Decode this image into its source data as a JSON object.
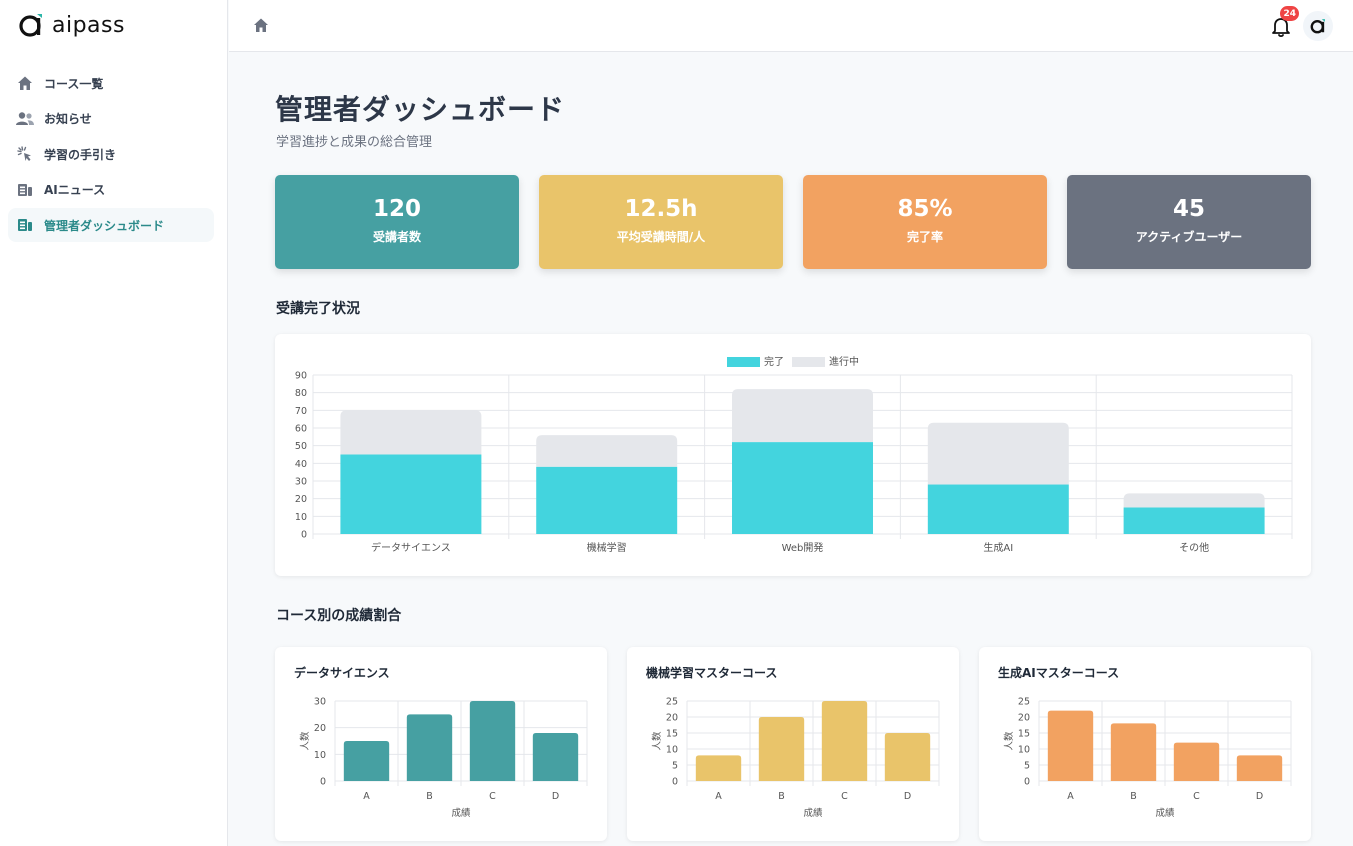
{
  "app": {
    "logo_text": "aipass"
  },
  "sidebar": {
    "items": [
      {
        "label": "コース一覧",
        "icon": "home-icon",
        "active": false
      },
      {
        "label": "お知らせ",
        "icon": "users-icon",
        "active": false
      },
      {
        "label": "学習の手引き",
        "icon": "cursor-click-icon",
        "active": false
      },
      {
        "label": "AIニュース",
        "icon": "newspaper-icon",
        "active": false
      },
      {
        "label": "管理者ダッシュボード",
        "icon": "dashboard-icon",
        "active": true
      }
    ]
  },
  "header": {
    "notification_count": "24",
    "avatar_letter": "a"
  },
  "page": {
    "title": "管理者ダッシュボード",
    "subtitle": "学習進捗と成果の総合管理"
  },
  "stats": [
    {
      "value": "120",
      "label": "受講者数",
      "color": "#46a0a2"
    },
    {
      "value": "12.5h",
      "label": "平均受講時間/人",
      "color": "#e9c46a"
    },
    {
      "value": "85%",
      "label": "完了率",
      "color": "#f2a261"
    },
    {
      "value": "45",
      "label": "アクティブユーザー",
      "color": "#6b7280"
    }
  ],
  "sections": {
    "completion": "受講完了状況",
    "grades": "コース別の成績割合"
  },
  "chart_data": [
    {
      "type": "bar",
      "stacked": true,
      "categories": [
        "データサイエンス",
        "機械学習",
        "Web開発",
        "生成AI",
        "その他"
      ],
      "series": [
        {
          "name": "完了",
          "values": [
            45,
            38,
            52,
            28,
            15
          ],
          "color": "#43d4de"
        },
        {
          "name": "進行中",
          "values": [
            25,
            18,
            30,
            35,
            8
          ],
          "color": "#e5e7eb"
        }
      ],
      "ylim": [
        0,
        90
      ],
      "yticks": [
        0,
        10,
        20,
        30,
        40,
        50,
        60,
        70,
        80,
        90
      ],
      "legend": "top-center",
      "grid": true
    },
    {
      "type": "bar",
      "title": "データサイエンス",
      "categories": [
        "A",
        "B",
        "C",
        "D"
      ],
      "values": [
        15,
        25,
        30,
        18
      ],
      "color": "#46a0a2",
      "ylim": [
        0,
        30
      ],
      "yticks": [
        0,
        10,
        20,
        30
      ],
      "xlabel": "成績",
      "ylabel": "人数",
      "grid": true
    },
    {
      "type": "bar",
      "title": "機械学習マスターコース",
      "categories": [
        "A",
        "B",
        "C",
        "D"
      ],
      "values": [
        8,
        20,
        25,
        15
      ],
      "color": "#e9c46a",
      "ylim": [
        0,
        25
      ],
      "yticks": [
        0,
        5,
        10,
        15,
        20,
        25
      ],
      "xlabel": "成績",
      "ylabel": "人数",
      "grid": true
    },
    {
      "type": "bar",
      "title": "生成AIマスターコース",
      "categories": [
        "A",
        "B",
        "C",
        "D"
      ],
      "values": [
        22,
        18,
        12,
        8
      ],
      "color": "#f2a261",
      "ylim": [
        0,
        25
      ],
      "yticks": [
        0,
        5,
        10,
        15,
        20,
        25
      ],
      "xlabel": "成績",
      "ylabel": "人数",
      "grid": true
    }
  ]
}
